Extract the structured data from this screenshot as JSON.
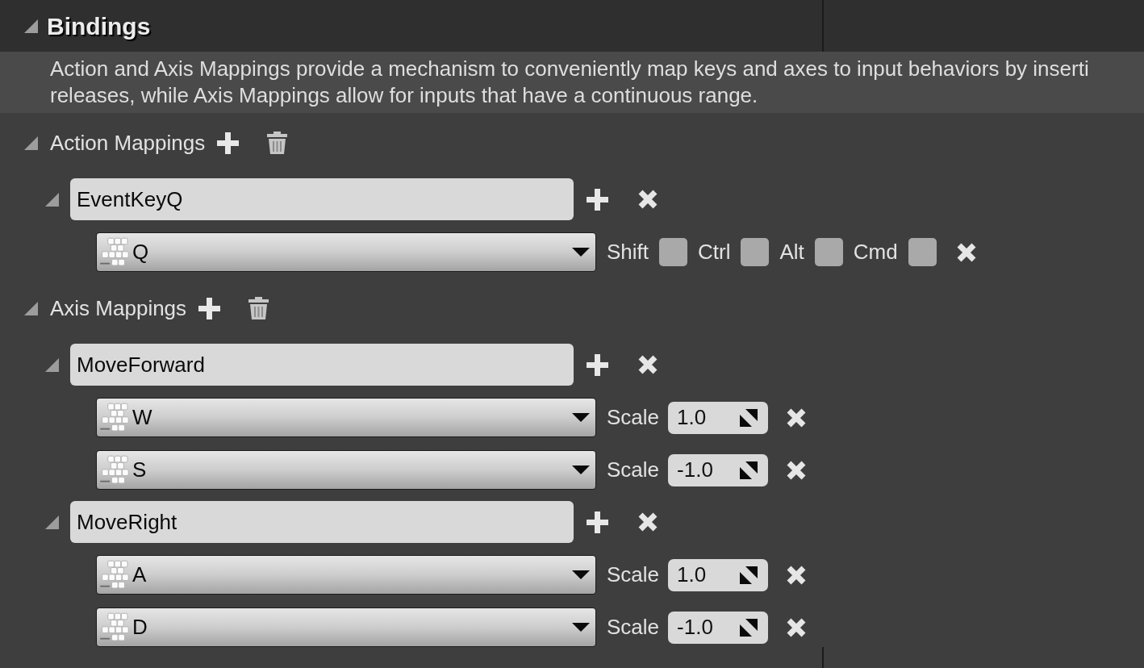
{
  "panel": {
    "title": "Bindings",
    "expanded": true,
    "description": [
      "Action and Axis Mappings provide a mechanism to conveniently map keys and axes to input behaviors by inserti",
      "releases, while Axis Mappings allow for inputs that have a continuous range."
    ]
  },
  "groups": [
    {
      "kind": "action",
      "label": "Action Mappings",
      "expanded": true,
      "mappings": [
        {
          "name": "EventKeyQ",
          "expanded": true,
          "keys": [
            {
              "key": "Q",
              "modifiers": [
                {
                  "label": "Shift",
                  "checked": false
                },
                {
                  "label": "Ctrl",
                  "checked": false
                },
                {
                  "label": "Alt",
                  "checked": false
                },
                {
                  "label": "Cmd",
                  "checked": false
                }
              ]
            }
          ]
        }
      ]
    },
    {
      "kind": "axis",
      "label": "Axis Mappings",
      "expanded": true,
      "mappings": [
        {
          "name": "MoveForward",
          "expanded": true,
          "keys": [
            {
              "key": "W",
              "scale_label": "Scale",
              "scale": "1.0"
            },
            {
              "key": "S",
              "scale_label": "Scale",
              "scale": "-1.0"
            }
          ]
        },
        {
          "name": "MoveRight",
          "expanded": true,
          "keys": [
            {
              "key": "A",
              "scale_label": "Scale",
              "scale": "1.0"
            },
            {
              "key": "D",
              "scale_label": "Scale",
              "scale": "-1.0"
            }
          ]
        }
      ]
    }
  ]
}
